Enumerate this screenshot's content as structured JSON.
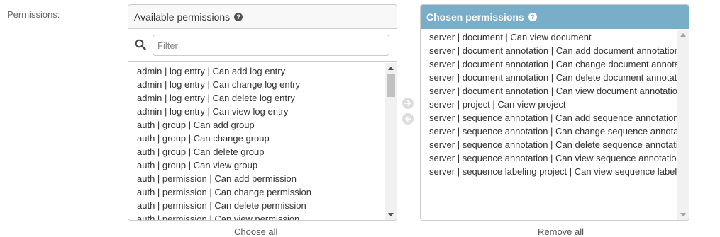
{
  "field": {
    "label": "Permissions:"
  },
  "available": {
    "title": "Available permissions",
    "help_icon": "question-circle-icon",
    "filter_placeholder": "Filter",
    "filter_value": "",
    "items": [
      "admin | log entry | Can add log entry",
      "admin | log entry | Can change log entry",
      "admin | log entry | Can delete log entry",
      "admin | log entry | Can view log entry",
      "auth | group | Can add group",
      "auth | group | Can change group",
      "auth | group | Can delete group",
      "auth | group | Can view group",
      "auth | permission | Can add permission",
      "auth | permission | Can change permission",
      "auth | permission | Can delete permission",
      "auth | permission | Can view permission"
    ],
    "choose_all_label": "Choose all"
  },
  "chosen": {
    "title": "Chosen permissions",
    "help_icon": "question-circle-icon",
    "items": [
      "server | document | Can view document",
      "server | document annotation | Can add document annotation",
      "server | document annotation | Can change document annotation",
      "server | document annotation | Can delete document annotation",
      "server | document annotation | Can view document annotation",
      "server | project | Can view project",
      "server | sequence annotation | Can add sequence annotation",
      "server | sequence annotation | Can change sequence annotation",
      "server | sequence annotation | Can delete sequence annotation",
      "server | sequence annotation | Can view sequence annotation",
      "server | sequence labeling project | Can view sequence labeling project"
    ],
    "remove_all_label": "Remove all"
  },
  "colors": {
    "chosen_header": "#79aec8",
    "available_header": "#f8f8f8",
    "border": "#cccccc"
  }
}
